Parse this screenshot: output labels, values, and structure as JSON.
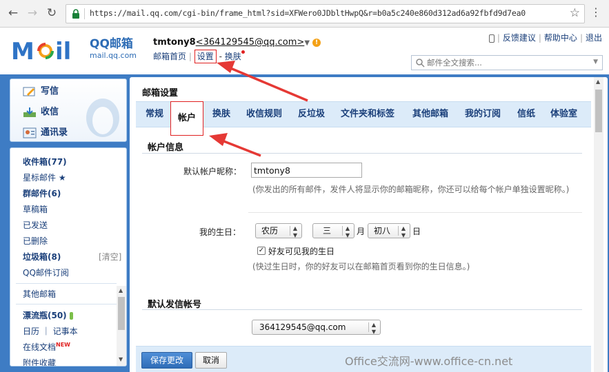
{
  "browser": {
    "url": "https://mail.qq.com/cgi-bin/frame_html?sid=XFWero0JDbltHwpQ&r=b0a5c240e860d312ad6a92fbfd9d7ea0",
    "back_icon": "arrow-left-icon",
    "forward_icon": "arrow-right-icon",
    "reload_icon": "reload-icon",
    "lock_icon": "lock-icon",
    "bookmark_icon": "star-outline-icon",
    "menu_icon": "kebab-menu-icon"
  },
  "header": {
    "logo_cn": "QQ邮箱",
    "logo_en": "mail.qq.com",
    "user_name": "tmtony8",
    "user_email": "<364129545@qq.com>",
    "user_caret": "▼",
    "warn_glyph": "!",
    "nav": {
      "home": "邮箱首页",
      "sep1": "|",
      "settings": "设置",
      "sep2": "-",
      "skin": "换肤"
    },
    "top_right": {
      "feedback": "反馈建议",
      "help": "帮助中心",
      "logout": "退出",
      "pipe": "|"
    },
    "search_placeholder": "邮件全文搜索..."
  },
  "sidebar": {
    "compose": "写信",
    "receive": "收信",
    "contacts": "通讯录",
    "folders": [
      {
        "label": "收件箱(77)",
        "bold": true
      },
      {
        "label": "星标邮件 ★",
        "bold": false
      },
      {
        "label": "群邮件(6)",
        "bold": true
      },
      {
        "label": "草稿箱",
        "bold": false
      },
      {
        "label": "已发送",
        "bold": false
      },
      {
        "label": "已删除",
        "bold": false
      },
      {
        "label": "垃圾箱(8)",
        "bold": true
      },
      {
        "label": "QQ邮件订阅",
        "bold": false
      },
      {
        "label": "其他邮箱",
        "bold": false
      },
      {
        "label": "漂流瓶(50)",
        "bold": true
      },
      {
        "label": "日历 ｜ 记事本",
        "bold": false
      },
      {
        "label": "在线文档",
        "bold": false
      },
      {
        "label": "附件收藏",
        "bold": false
      }
    ],
    "trash_clear": "[清空]",
    "new_badge": "NEW"
  },
  "main": {
    "title": "邮箱设置",
    "tabs": [
      "常规",
      "帐户",
      "换肤",
      "收信规则",
      "反垃圾",
      "文件夹和标签",
      "其他邮箱",
      "我的订阅",
      "信纸",
      "体验室"
    ],
    "active_tab": "帐户",
    "account_section": "帐户信息",
    "nickname_label": "默认帐户昵称：",
    "nickname_value": "tmtony8",
    "nickname_hint": "(你发出的所有邮件，发件人将显示你的邮箱昵称，你还可以给每个帐户单独设置昵称。)",
    "birthday_label": "我的生日：",
    "calendar_value": "农历",
    "month_value": "三",
    "month_unit": "月",
    "day_value": "初八",
    "day_unit": "日",
    "friends_see_label": "好友可见我的生日",
    "friends_see_checked": true,
    "birthday_hint": "(快过生日时，你的好友可以在邮箱首页看到你的生日信息。)",
    "default_sender_section": "默认发信帐号",
    "default_sender_value": "364129545@qq.com",
    "save_button": "保存更改",
    "cancel_button": "取消"
  },
  "watermark": "Office交流网-www.office-cn.net",
  "colors": {
    "frame_blue": "#3e7cc4",
    "tab_bg": "#dcebf9",
    "highlight_red": "#e02020",
    "link_blue": "#1a3f7a"
  }
}
